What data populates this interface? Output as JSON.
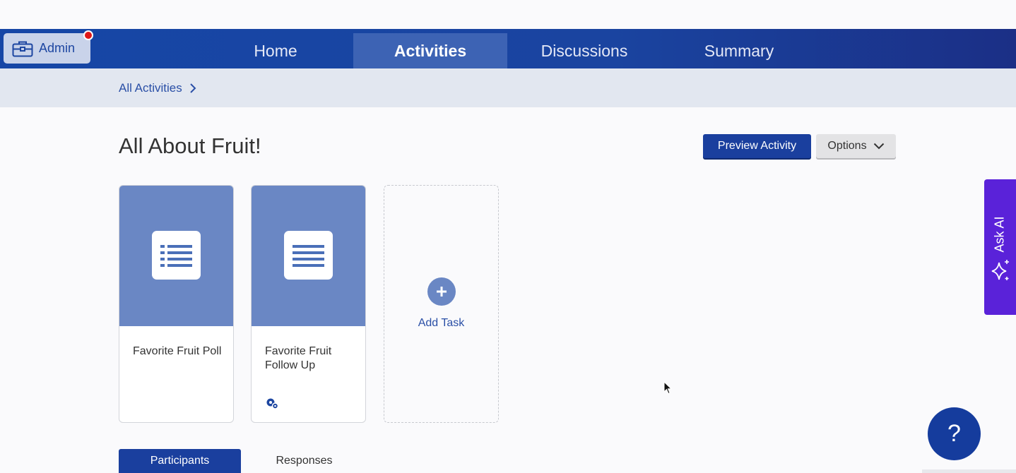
{
  "navbar": {
    "admin_label": "Admin",
    "tabs": [
      {
        "label": "Home",
        "active": false
      },
      {
        "label": "Activities",
        "active": true
      },
      {
        "label": "Discussions",
        "active": false
      },
      {
        "label": "Summary",
        "active": false
      }
    ],
    "colors": {
      "bar": "#1a44a0",
      "active_tab": "#3d63b4",
      "notification": "#e01818"
    }
  },
  "breadcrumb": {
    "label": "All Activities"
  },
  "page": {
    "title": "All About Fruit!",
    "preview_label": "Preview Activity",
    "options_label": "Options"
  },
  "tasks": [
    {
      "label": "Favorite Fruit Poll",
      "icon": "list-icon"
    },
    {
      "label": "Favorite Fruit Follow Up",
      "icon": "text-lines-icon",
      "badge_icon": "settings-gear-icon"
    }
  ],
  "add_task": {
    "label": "Add Task"
  },
  "ask_ai": {
    "label": "Ask AI"
  },
  "help": {
    "label": "?"
  },
  "bottom_tabs": [
    {
      "label": "Participants",
      "active": true
    },
    {
      "label": "Responses",
      "active": false
    }
  ],
  "colors": {
    "accent": "#1a3f9e",
    "card_top": "#6a87c4",
    "ask_ai": "#5a22d9"
  }
}
